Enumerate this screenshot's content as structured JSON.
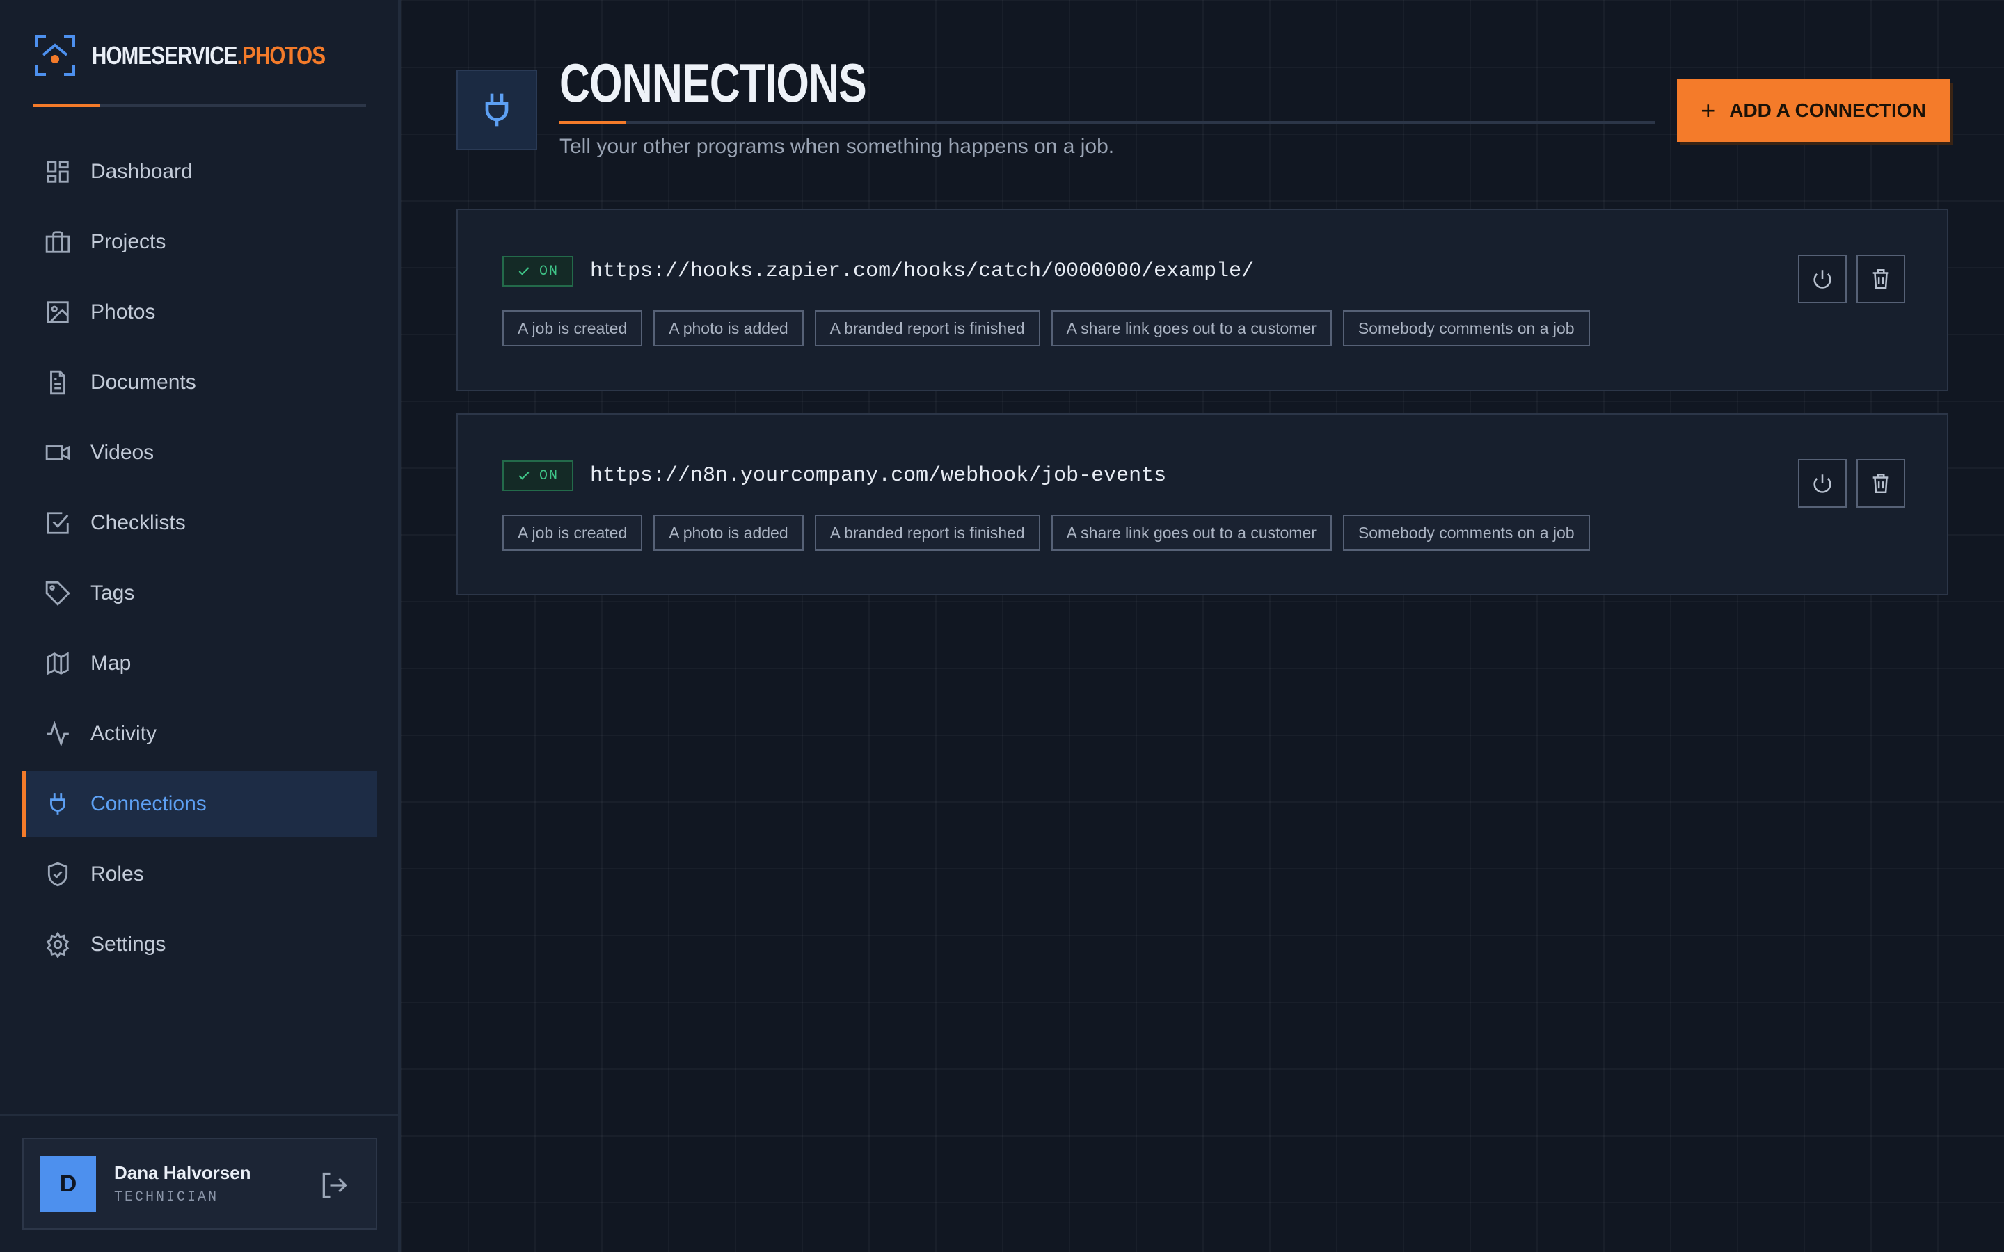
{
  "brand": {
    "name_main": "HOMESERVICE",
    "name_accent": ".PHOTOS",
    "icon": "camera-frame-icon",
    "accent_color": "#f47b2a"
  },
  "sidebar": {
    "items": [
      {
        "label": "Dashboard",
        "icon": "dashboard-icon"
      },
      {
        "label": "Projects",
        "icon": "briefcase-icon"
      },
      {
        "label": "Photos",
        "icon": "image-icon"
      },
      {
        "label": "Documents",
        "icon": "document-icon"
      },
      {
        "label": "Videos",
        "icon": "video-icon"
      },
      {
        "label": "Checklists",
        "icon": "checkbox-icon"
      },
      {
        "label": "Tags",
        "icon": "tag-icon"
      },
      {
        "label": "Map",
        "icon": "map-icon"
      },
      {
        "label": "Activity",
        "icon": "activity-icon"
      },
      {
        "label": "Connections",
        "icon": "plug-icon",
        "active": true
      },
      {
        "label": "Roles",
        "icon": "shield-check-icon"
      },
      {
        "label": "Settings",
        "icon": "gear-icon"
      }
    ],
    "active_color": "#5da0f4"
  },
  "user": {
    "initial": "D",
    "name": "Dana Halvorsen",
    "role": "TECHNICIAN"
  },
  "page": {
    "title": "CONNECTIONS",
    "subtitle": "Tell your other programs when something happens on a job.",
    "add_button": "ADD A CONNECTION"
  },
  "connections": [
    {
      "status": "ON",
      "url": "https://hooks.zapier.com/hooks/catch/0000000/example/",
      "events": [
        "A job is created",
        "A photo is added",
        "A branded report is finished",
        "A share link goes out to a customer",
        "Somebody comments on a job"
      ]
    },
    {
      "status": "ON",
      "url": "https://n8n.yourcompany.com/webhook/job-events",
      "events": [
        "A job is created",
        "A photo is added",
        "A branded report is finished",
        "A share link goes out to a customer",
        "Somebody comments on a job"
      ]
    }
  ],
  "colors": {
    "on_status": "#3fc487",
    "background": "#111722",
    "sidebar": "#161e2c"
  }
}
